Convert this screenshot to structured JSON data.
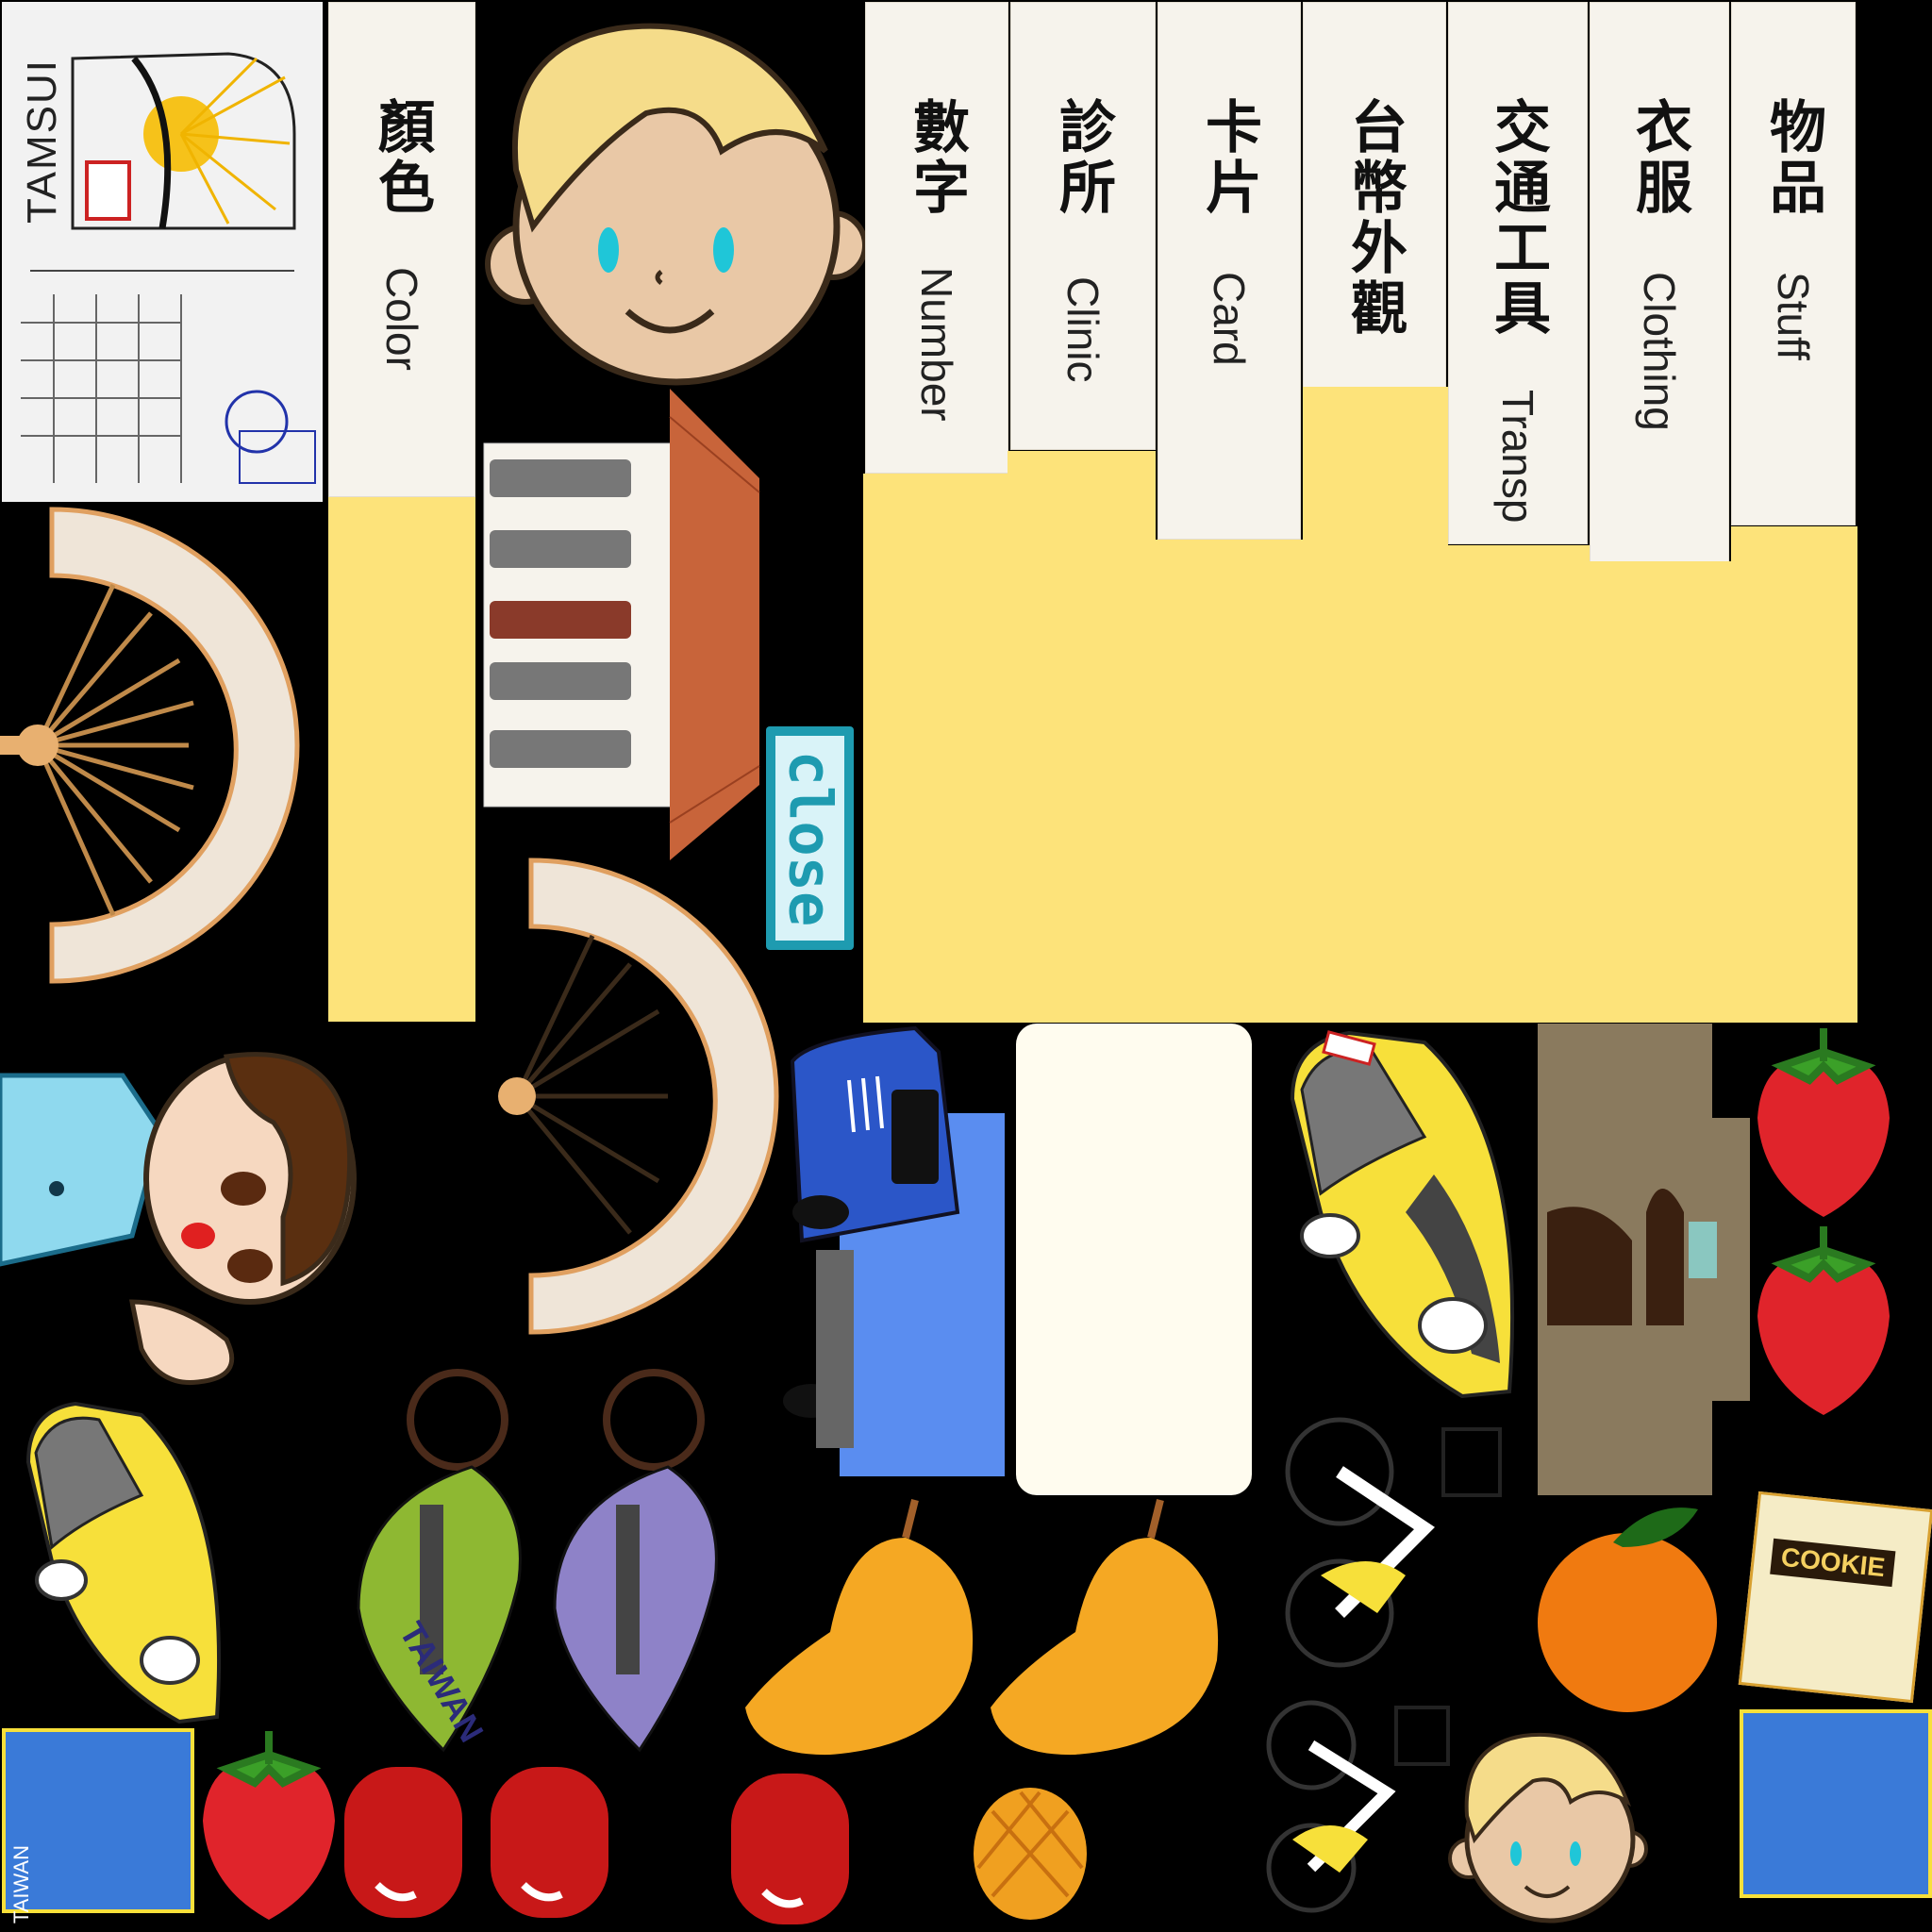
{
  "tabs": [
    {
      "zh": "顏色",
      "en": "Color"
    },
    {
      "zh": "數字",
      "en": "Number"
    },
    {
      "zh": "診所",
      "en": "Clinic"
    },
    {
      "zh": "卡片",
      "en": "Card"
    },
    {
      "zh": "台幣外觀",
      "en": ""
    },
    {
      "zh": "交通工具",
      "en": "Transp"
    },
    {
      "zh": "衣服",
      "en": "Clothing"
    },
    {
      "zh": "物品",
      "en": "Stuff"
    }
  ],
  "close_label": "close",
  "postcard_stamp": "TAMSUI",
  "keychain_text": "TAIWAN",
  "cookie_label": "COOKIE",
  "metro_card_text": "TAIWAN",
  "colors": {
    "paper": "#f6f3ec",
    "yellow_panel": "#fde37a",
    "accent_teal": "#1e9bb0",
    "taxi_yellow": "#f7e03a",
    "strawberry_red": "#e0242b",
    "mango_orange": "#f5a823",
    "truck_blue": "#2b56c8"
  }
}
